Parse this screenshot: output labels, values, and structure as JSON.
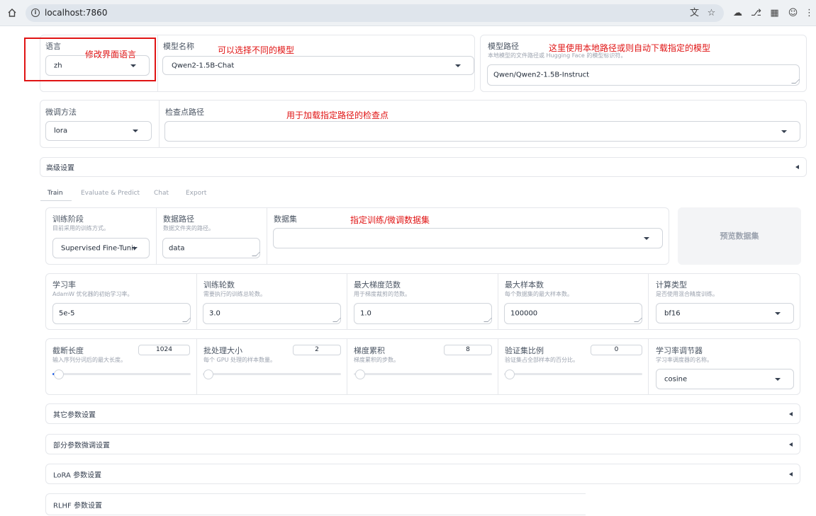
{
  "browser": {
    "url": "localhost:7860",
    "toolbar_icons": [
      "translate-icon",
      "star-icon",
      "cloud-icon",
      "extension-icon",
      "grid-icon",
      "profile-icon",
      "menu-icon"
    ]
  },
  "top": {
    "lang": {
      "label": "语言",
      "value": "zh"
    },
    "model_name": {
      "label": "模型名称",
      "value": "Qwen2-1.5B-Chat"
    },
    "model_path": {
      "label": "模型路径",
      "hint": "本地模型的文件路径或 Hugging Face 的模型标识符。",
      "value": "Qwen/Qwen2-1.5B-Instruct"
    }
  },
  "row2": {
    "finetune": {
      "label": "微调方法",
      "value": "lora"
    },
    "checkpoint": {
      "label": "检查点路径",
      "value": ""
    }
  },
  "advanced": {
    "label": "高级设置"
  },
  "tabs": [
    "Train",
    "Evaluate & Predict",
    "Chat",
    "Export"
  ],
  "train": {
    "stage": {
      "label": "训练阶段",
      "hint": "目前采用的训练方式。",
      "value": "Supervised Fine-Tuning"
    },
    "data_dir": {
      "label": "数据路径",
      "hint": "数据文件夹的路径。",
      "value": "data"
    },
    "dataset": {
      "label": "数据集",
      "value": ""
    },
    "preview_button": "预览数据集",
    "lr": {
      "label": "学习率",
      "hint": "AdamW 优化器的初始学习率。",
      "value": "5e-5"
    },
    "epochs": {
      "label": "训练轮数",
      "hint": "需要执行的训练总轮数。",
      "value": "3.0"
    },
    "grad_norm": {
      "label": "最大梯度范数",
      "hint": "用于梯度裁剪的范数。",
      "value": "1.0"
    },
    "max_samples": {
      "label": "最大样本数",
      "hint": "每个数据集的最大样本数。",
      "value": "100000"
    },
    "compute_type": {
      "label": "计算类型",
      "hint": "是否使用混合精度训练。",
      "value": "bf16"
    },
    "cutoff": {
      "label": "截断长度",
      "hint": "输入序列分词后的最大长度。",
      "value": "1024",
      "slider": 0.03
    },
    "batch": {
      "label": "批处理大小",
      "hint": "每个 GPU 处理的样本数量。",
      "value": "2",
      "slider": 0.0
    },
    "grad_accum": {
      "label": "梯度累积",
      "hint": "梯度累积的步数。",
      "value": "8",
      "slider": 0.02
    },
    "val_size": {
      "label": "验证集比例",
      "hint": "验证集占全部样本的百分比。",
      "value": "0",
      "slider": 0.0
    },
    "scheduler": {
      "label": "学习率调节器",
      "hint": "学习率调度器的名称。",
      "value": "cosine"
    }
  },
  "accordions": [
    "其它参数设置",
    "部分参数微调设置",
    "LoRA 参数设置",
    "RLHF 参数设置"
  ],
  "annotations": {
    "a1": "修改界面语言",
    "a2": "可以选择不同的模型",
    "a3": "这里使用本地路径或则自动下载指定的模型",
    "a4": "用于加载指定路径的检查点",
    "a5": "指定训练/微调数据集"
  },
  "colors": {
    "annotation": "#e01414",
    "border": "#e5e7eb"
  }
}
